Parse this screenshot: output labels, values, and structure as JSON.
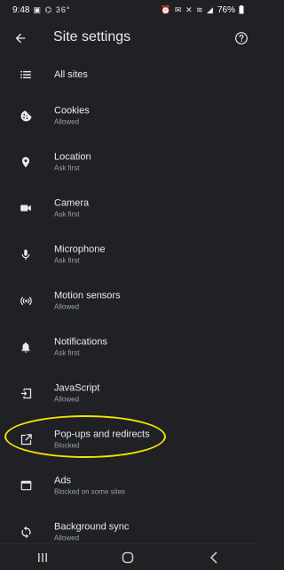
{
  "status_bar": {
    "time": "9:48",
    "left_icons": "▣ ⌬ 36°",
    "right_icons": "⏰ ✉ ✕ ≋ ◢",
    "battery": "76%"
  },
  "app_bar": {
    "title": "Site settings",
    "back_icon": "arrow-back-icon",
    "help_icon": "help-icon"
  },
  "settings": {
    "items": [
      {
        "title": "All sites",
        "subtitle": "",
        "icon": "list-icon"
      },
      {
        "title": "Cookies",
        "subtitle": "Allowed",
        "icon": "cookie-icon"
      },
      {
        "title": "Location",
        "subtitle": "Ask first",
        "icon": "location-pin-icon"
      },
      {
        "title": "Camera",
        "subtitle": "Ask first",
        "icon": "camera-icon"
      },
      {
        "title": "Microphone",
        "subtitle": "Ask first",
        "icon": "microphone-icon"
      },
      {
        "title": "Motion sensors",
        "subtitle": "Allowed",
        "icon": "motion-sensor-icon"
      },
      {
        "title": "Notifications",
        "subtitle": "Ask first",
        "icon": "bell-icon"
      },
      {
        "title": "JavaScript",
        "subtitle": "Allowed",
        "icon": "javascript-icon"
      },
      {
        "title": "Pop-ups and redirects",
        "subtitle": "Blocked",
        "icon": "open-in-new-icon"
      },
      {
        "title": "Ads",
        "subtitle": "Blocked on some sites",
        "icon": "ads-icon"
      },
      {
        "title": "Background sync",
        "subtitle": "Allowed",
        "icon": "sync-icon"
      }
    ]
  },
  "annotation": {
    "color": "#f5e400",
    "highlighted_item": "Pop-ups and redirects"
  },
  "nav_bar": {
    "buttons": [
      "recents-icon",
      "home-icon",
      "back-nav-icon"
    ]
  }
}
